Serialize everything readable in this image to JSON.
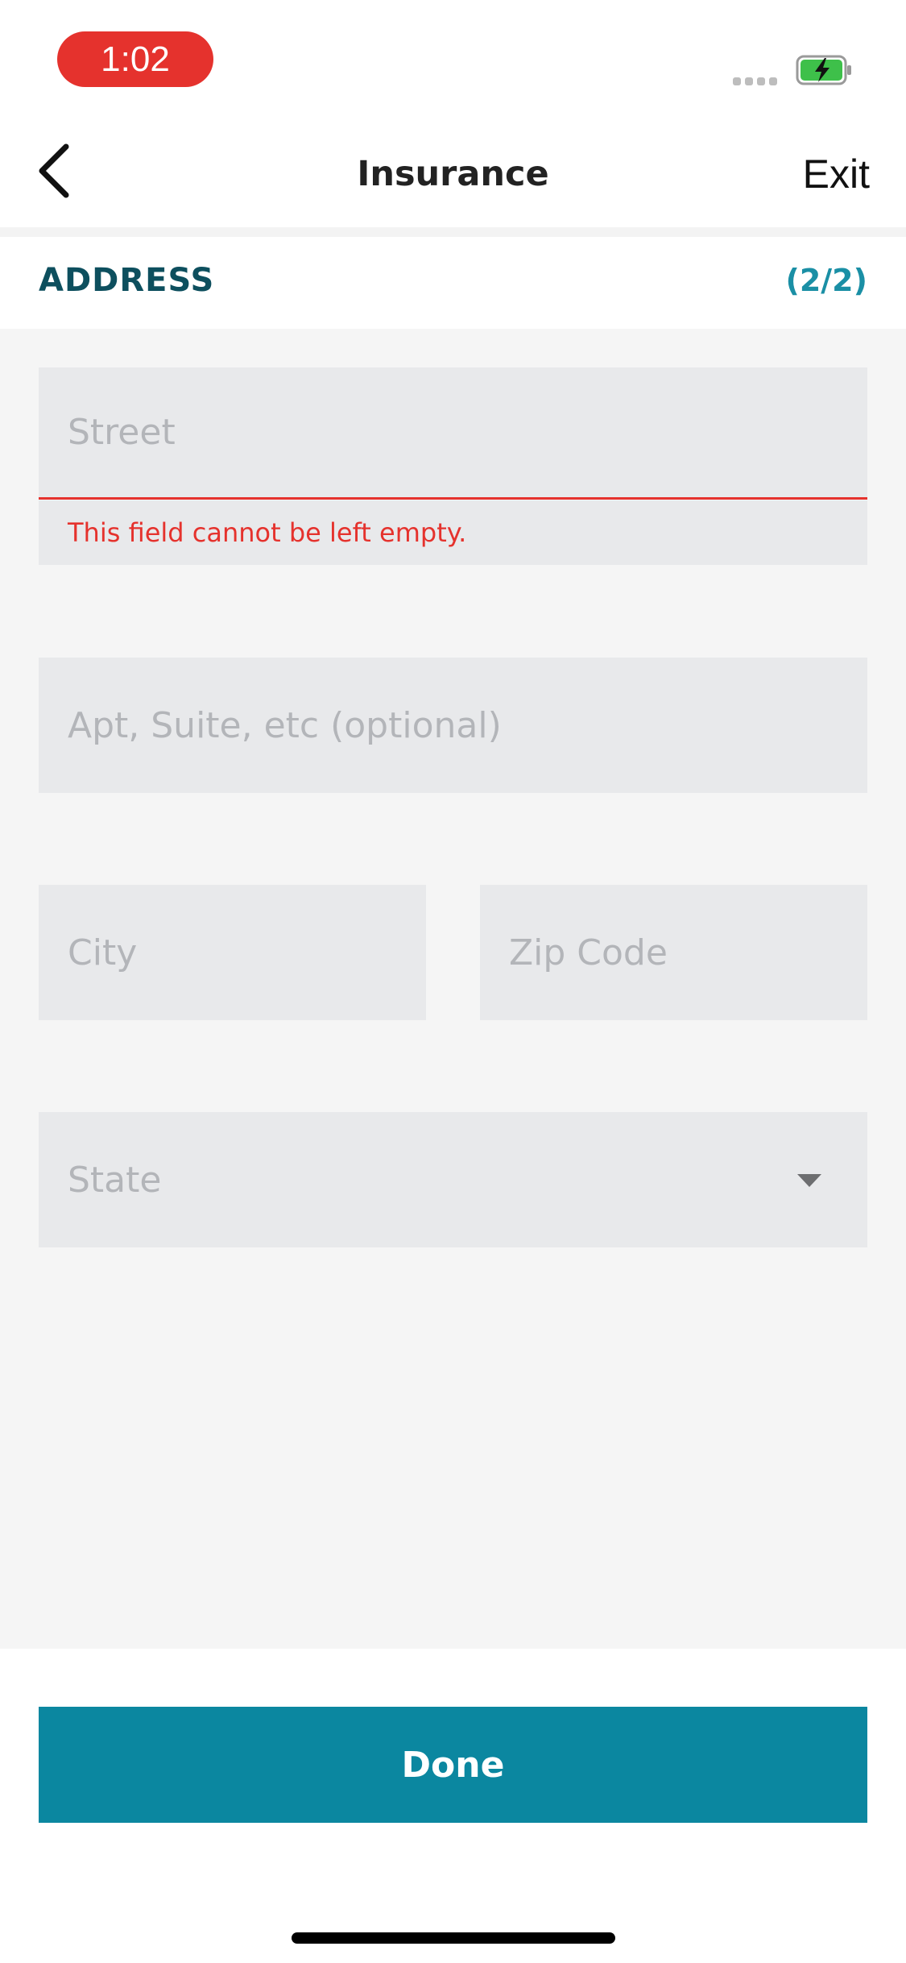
{
  "status_bar": {
    "time": "1:02",
    "time_pill_color": "#e5322d",
    "battery_icon": "battery-charging-icon",
    "battery_color": "#3ec04a",
    "signal_icon": "signal-icon"
  },
  "nav": {
    "back_icon": "chevron-left-icon",
    "title": "Insurance",
    "exit_label": "Exit"
  },
  "section": {
    "title": "ADDRESS",
    "step": "(2/2)"
  },
  "form": {
    "street": {
      "placeholder": "Street",
      "value": "",
      "error": "This field cannot be left empty."
    },
    "apt": {
      "placeholder": "Apt, Suite, etc (optional)",
      "value": ""
    },
    "city": {
      "placeholder": "City",
      "value": ""
    },
    "zip": {
      "placeholder": "Zip Code",
      "value": ""
    },
    "state": {
      "placeholder": "State",
      "value": "",
      "dropdown_icon": "caret-down-icon"
    }
  },
  "actions": {
    "done_label": "Done",
    "done_color": "#0b87a0"
  },
  "colors": {
    "error": "#e5322d",
    "section_title": "#0d4f5e",
    "step_accent": "#1a8fa5",
    "field_bg": "#e8e9eb",
    "placeholder": "#b3b5b9"
  }
}
